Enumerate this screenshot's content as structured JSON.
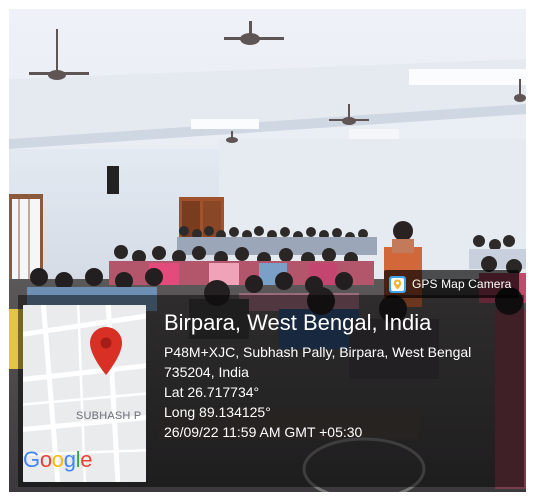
{
  "badge": {
    "text": "GPS Map Camera",
    "icon": "gps-map-camera-icon"
  },
  "map": {
    "street_label": "SUBHASH P",
    "logo": [
      "G",
      "o",
      "o",
      "g",
      "l",
      "e"
    ],
    "pin_icon": "map-pin-icon",
    "pin_color": "#d93025"
  },
  "location": {
    "place": "Birpara, West Bengal, India",
    "address_line_1": "P48M+XJC, Subhash Pally, Birpara, West Bengal",
    "address_line_2": "735204, India",
    "latitude": "Lat 26.717734°",
    "longitude": "Long 89.134125°",
    "datetime": "26/09/22 11:59 AM GMT +05:30"
  },
  "colors": {
    "overlay": "#000000",
    "text": "#ffffff",
    "map_background": "#e9ebed"
  }
}
